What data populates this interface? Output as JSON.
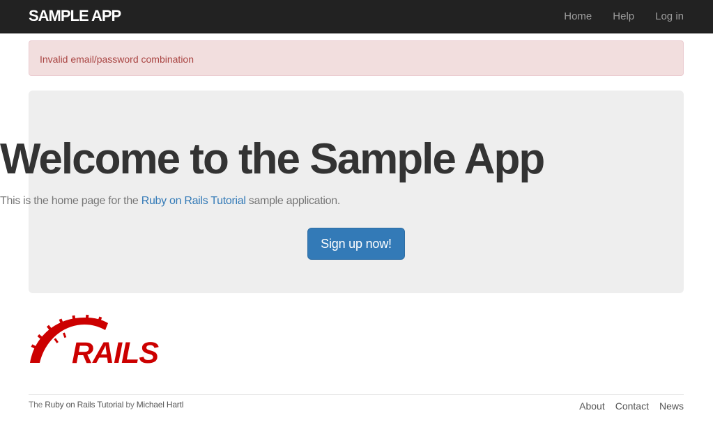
{
  "navbar": {
    "logo": "sample app",
    "links": [
      {
        "label": "Home"
      },
      {
        "label": "Help"
      },
      {
        "label": "Log in"
      }
    ]
  },
  "alert": {
    "message": "Invalid email/password combination"
  },
  "jumbotron": {
    "title": "Welcome to the Sample App",
    "text_before": "This is the home page for the ",
    "link_text": "Ruby on Rails Tutorial",
    "text_after": " sample application.",
    "button_label": "Sign up now!"
  },
  "rails_logo": {
    "text": "RAILS",
    "color": "#cc0000"
  },
  "footer": {
    "prefix": "The ",
    "tutorial_link": "Ruby on Rails Tutorial",
    "by": " by ",
    "author_link": "Michael Hartl",
    "links": [
      {
        "label": "About"
      },
      {
        "label": "Contact"
      },
      {
        "label": "News"
      }
    ]
  },
  "colors": {
    "navbar_bg": "#222222",
    "alert_bg": "#f2dede",
    "alert_text": "#a94442",
    "jumbotron_bg": "#eeeeee",
    "primary": "#337ab7",
    "rails_red": "#cc0000"
  }
}
